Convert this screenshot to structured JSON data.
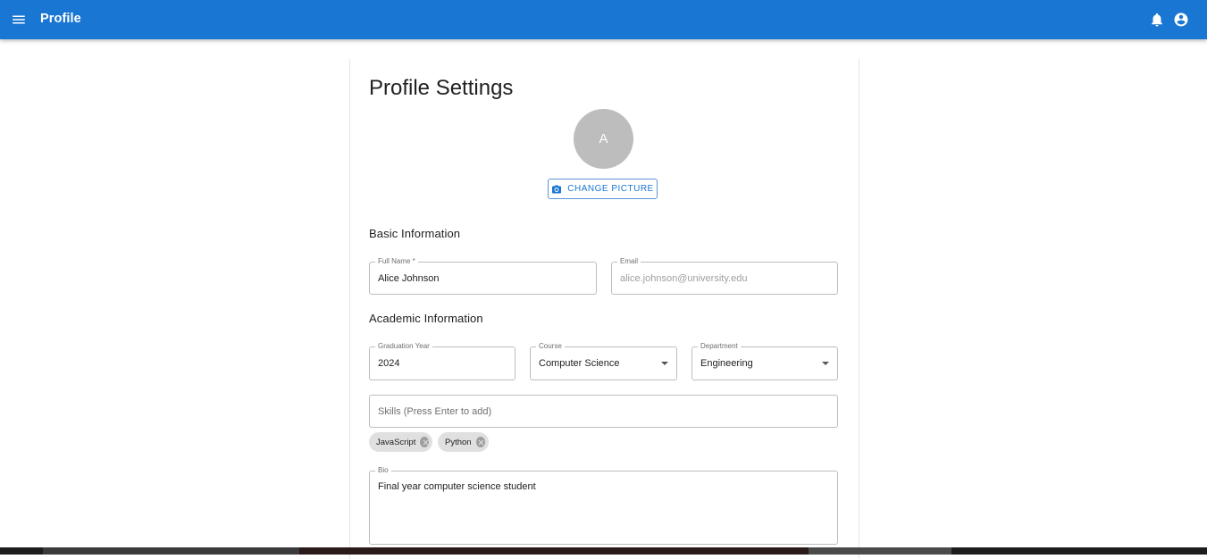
{
  "appbar": {
    "title": "Profile",
    "menu_icon": "menu-icon",
    "notifications_icon": "bell-icon",
    "account_icon": "account-circle-icon"
  },
  "page": {
    "title": "Profile Settings"
  },
  "avatar": {
    "initial": "A"
  },
  "change_picture": {
    "label": "CHANGE PICTURE",
    "icon": "camera-icon"
  },
  "sections": {
    "basic": "Basic Information",
    "academic": "Academic Information"
  },
  "fields": {
    "full_name": {
      "label": "Full Name *",
      "value": "Alice Johnson"
    },
    "email": {
      "label": "Email",
      "value": "alice.johnson@university.edu"
    },
    "graduation_year": {
      "label": "Graduation Year",
      "value": "2024"
    },
    "course": {
      "label": "Course",
      "value": "Computer Science"
    },
    "department": {
      "label": "Department",
      "value": "Engineering"
    },
    "skills": {
      "placeholder": "Skills (Press Enter to add)"
    },
    "bio": {
      "label": "Bio",
      "value": "Final year computer science student"
    }
  },
  "skills": [
    "JavaScript",
    "Python"
  ],
  "colors": {
    "primary": "#1976d2",
    "avatar_bg": "#bdbdbd",
    "chip_bg": "#e0e0e0"
  }
}
